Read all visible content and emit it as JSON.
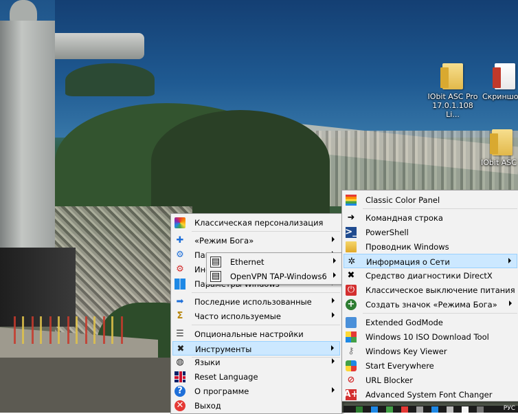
{
  "desktop": {
    "icons": [
      {
        "label": "IObit ASC Pro 17.0.1.108 Li...",
        "icon": "folder-icon"
      },
      {
        "label": "Скриншот",
        "icon": "document-icon"
      },
      {
        "label": "IObit ASC P",
        "icon": "folder-icon"
      }
    ]
  },
  "main_menu": {
    "items": [
      {
        "label": "Классическая персонализация",
        "icon": "color-wheel-icon",
        "submenu": false
      },
      {
        "label": "«Режим Бога»",
        "icon": "plus-icon",
        "submenu": true
      },
      {
        "label": "Пан",
        "icon": "gear-icon",
        "submenu": true
      },
      {
        "label": "Инс",
        "icon": "gear-red-icon",
        "submenu": true
      },
      {
        "label": "Параметры Windows",
        "icon": "windows-icon",
        "submenu": true
      },
      {
        "label": "Последние использованные",
        "icon": "arrow-right-icon",
        "submenu": true
      },
      {
        "label": "Часто используемые",
        "icon": "sigma-icon",
        "submenu": true
      },
      {
        "label": "Опциональные настройки",
        "icon": "sliders-icon",
        "submenu": false
      },
      {
        "label": "Инструменты",
        "icon": "tools-icon",
        "submenu": true,
        "highlighted": true
      },
      {
        "label": "Языки",
        "icon": "globe-icon",
        "submenu": true
      },
      {
        "label": "Reset Language",
        "icon": "uk-flag-icon",
        "submenu": false
      },
      {
        "label": "О программе",
        "icon": "help-icon",
        "submenu": true
      },
      {
        "label": "Выход",
        "icon": "exit-icon",
        "submenu": false
      }
    ]
  },
  "network_menu": {
    "items": [
      {
        "label": "Ethernet",
        "icon": "network-adapter-icon",
        "submenu": true
      },
      {
        "label": "OpenVPN TAP-Windows6",
        "icon": "network-adapter-icon",
        "submenu": true
      }
    ]
  },
  "tools_menu": {
    "items": [
      {
        "label": "Classic Color Panel",
        "icon": "rainbow-icon",
        "submenu": false
      },
      {
        "label": "Командная строка",
        "icon": "black-arrow-icon",
        "submenu": false
      },
      {
        "label": "PowerShell",
        "icon": "powershell-icon",
        "submenu": false
      },
      {
        "label": "Проводник Windows",
        "icon": "explorer-icon",
        "submenu": false
      },
      {
        "label": "Информация о Сети",
        "icon": "network-icon",
        "submenu": true,
        "highlighted": true
      },
      {
        "label": "Средство диагностики DirectX",
        "icon": "directx-icon",
        "submenu": false
      },
      {
        "label": "Классическое выключение питания",
        "icon": "power-icon",
        "submenu": false
      },
      {
        "label": "Создать значок «Режима Бога»",
        "icon": "green-plus-icon",
        "submenu": true
      },
      {
        "label": "Extended GodMode",
        "icon": "godmode-icon",
        "submenu": false
      },
      {
        "label": "Windows 10 ISO Download Tool",
        "icon": "windows10-icon",
        "submenu": false
      },
      {
        "label": "Windows Key Viewer",
        "icon": "key-icon",
        "submenu": false
      },
      {
        "label": "Start Everywhere",
        "icon": "start-icon",
        "submenu": false
      },
      {
        "label": "URL Blocker",
        "icon": "block-icon",
        "submenu": false
      },
      {
        "label": "Advanced System Font Changer",
        "icon": "font-icon",
        "submenu": false
      }
    ]
  },
  "taskbar": {
    "language": "РУС"
  }
}
